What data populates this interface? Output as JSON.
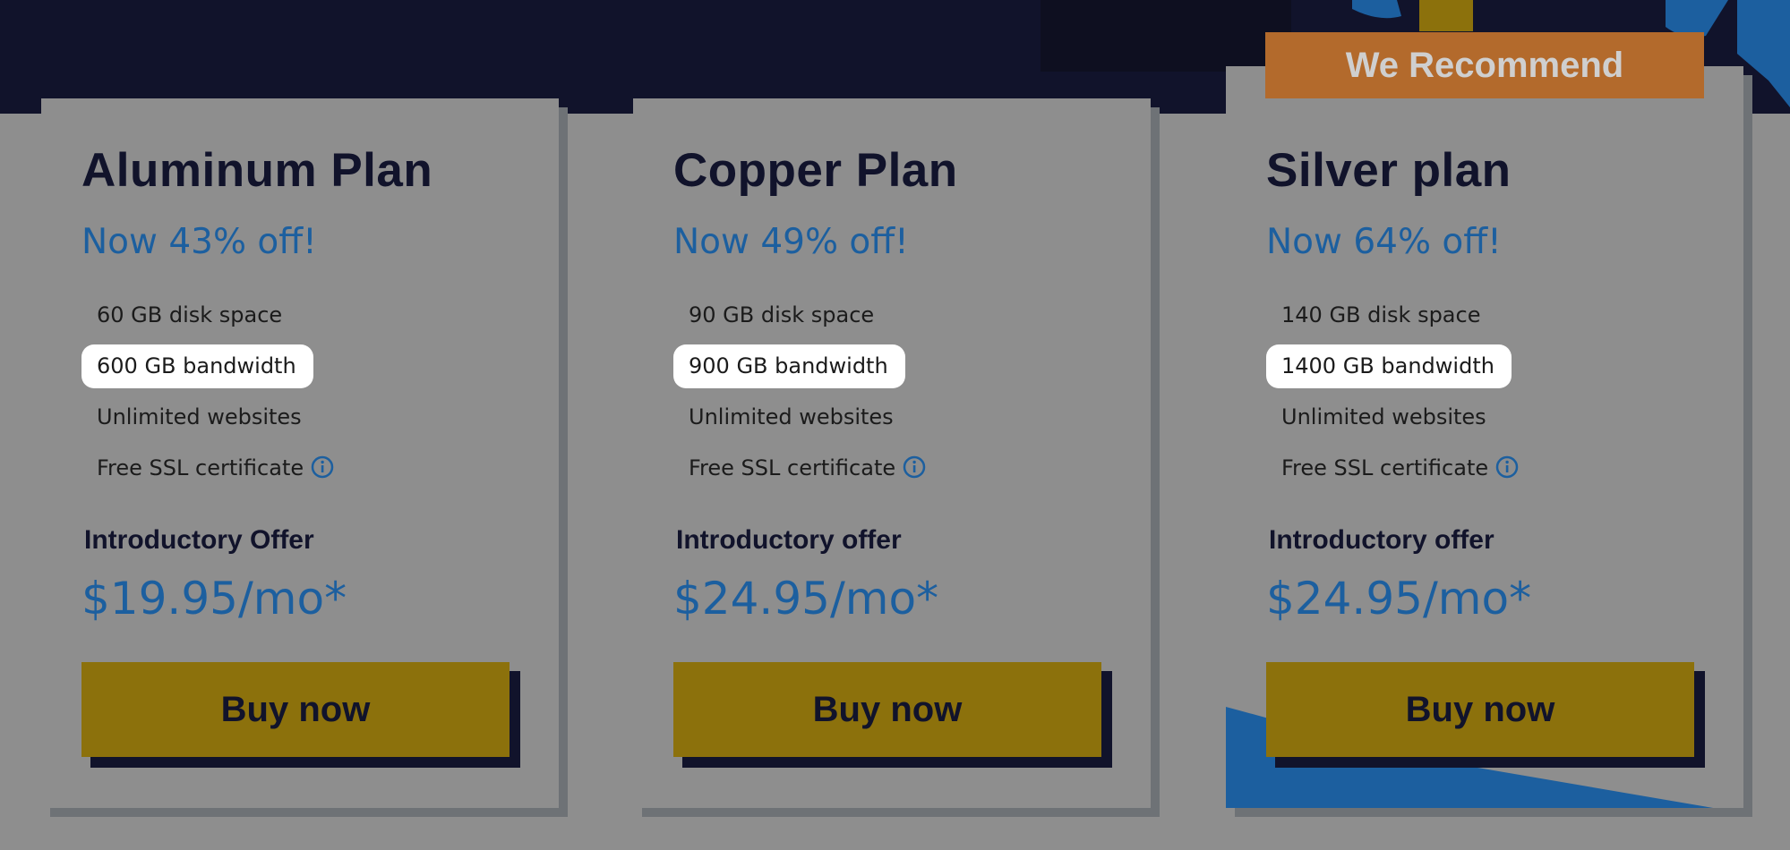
{
  "colors": {
    "background": "#8e8e8e",
    "header_band": "#11132b",
    "accent_blue": "#1c5f9f",
    "button": "#8c710c",
    "recommend_badge": "#b36a2c"
  },
  "badge": {
    "label": "We Recommend"
  },
  "plans": [
    {
      "title": "Aluminum Plan",
      "discount": "Now 43% off!",
      "features": [
        "60 GB disk space",
        "600 GB bandwidth",
        "Unlimited websites",
        "Free SSL certificate"
      ],
      "offer_label": "Introductory Offer",
      "price": "$19.95/mo*",
      "button": "Buy now"
    },
    {
      "title": "Copper Plan",
      "discount": "Now 49% off!",
      "features": [
        "90 GB disk space",
        "900 GB bandwidth",
        "Unlimited websites",
        "Free SSL certificate"
      ],
      "offer_label": "Introductory offer",
      "price": "$24.95/mo*",
      "button": "Buy now"
    },
    {
      "title": "Silver plan",
      "discount": "Now 64% off!",
      "features": [
        "140 GB disk space",
        "1400 GB bandwidth",
        "Unlimited websites",
        "Free SSL certificate"
      ],
      "offer_label": "Introductory offer",
      "price": "$24.95/mo*",
      "button": "Buy now"
    }
  ],
  "icons": {
    "ssl_info": "info-circle-icon"
  }
}
